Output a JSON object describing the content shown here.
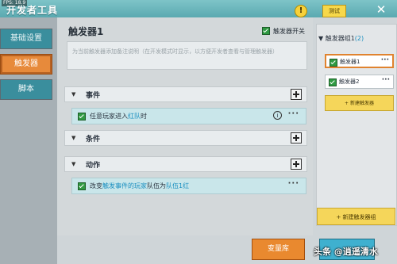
{
  "header": {
    "fps": "FPS: 18.9",
    "title": "开发者工具",
    "warning_symbol": "!",
    "test_label": "测试",
    "close_symbol": "✕"
  },
  "sidebar": {
    "items": [
      {
        "label": "基础设置",
        "active": false
      },
      {
        "label": "触发器",
        "active": true
      },
      {
        "label": "脚本",
        "active": false
      }
    ]
  },
  "main": {
    "title": "触发器1",
    "switch_label": "触发器开关",
    "switch_on": true,
    "description_placeholder": "为当前触发器添加备注说明（在开发模式时显示，以方便开发者查看与管理触发器）",
    "sections": {
      "event": {
        "label": "事件"
      },
      "condition": {
        "label": "条件"
      },
      "action": {
        "label": "动作"
      }
    },
    "event_row": {
      "pre": "任意玩家进入",
      "highlight": "红队",
      "post": "时",
      "info_symbol": "i",
      "more": "···"
    },
    "action_row": {
      "pre": "改变",
      "highlight1": "触发事件的玩家",
      "mid": "队伍为",
      "highlight2": "队伍1红",
      "more": "···"
    }
  },
  "right_panel": {
    "group_name": "触发器组1",
    "group_count": "(2)",
    "triggers": [
      {
        "label": "触发器1",
        "active": true,
        "more": "···"
      },
      {
        "label": "触发器2",
        "active": false,
        "more": "···"
      }
    ],
    "new_trigger_label": "+ 新建触发器",
    "new_group_label": "+ 新建触发器组"
  },
  "bottom": {
    "variables_label": "变量库",
    "watermark": "头条 @逍遥清水"
  },
  "colors": {
    "accent_orange": "#e78a3b",
    "teal": "#3a8e9d",
    "yellow": "#f5d65a",
    "highlight_blue": "#1a8fc0",
    "check_green": "#2f9a42"
  }
}
